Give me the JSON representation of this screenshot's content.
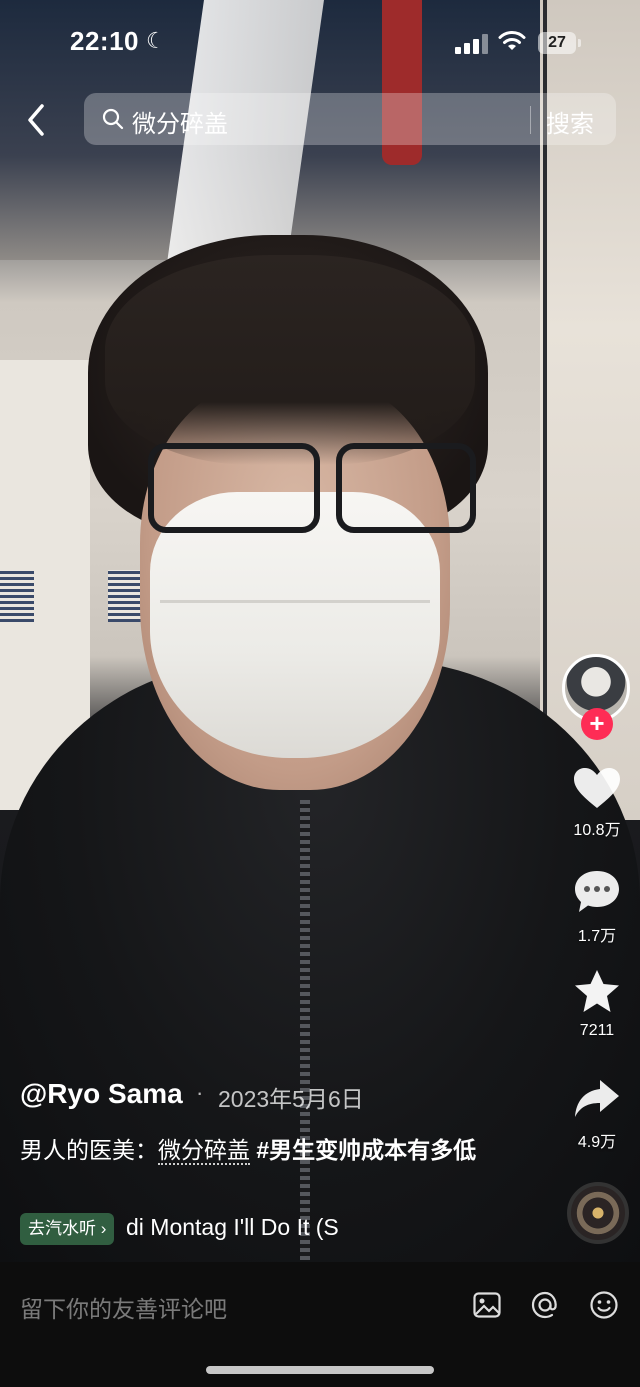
{
  "status": {
    "time": "22:10",
    "battery": "27"
  },
  "search": {
    "query": "微分碎盖",
    "button": "搜索"
  },
  "actions": {
    "likes": "10.8万",
    "comments": "1.7万",
    "favorites": "7211",
    "shares": "4.9万"
  },
  "post": {
    "author": "@Ryo Sama",
    "separator": "·",
    "date": "2023年5月6日",
    "desc_prefix": "男人的医美：",
    "desc_keyword": "微分碎盖",
    "desc_tag": " #男生变帅成本有多低",
    "music_chip": "去汽水听",
    "music_text": "di Montag   I'll Do It (S"
  },
  "comment": {
    "placeholder": "留下你的友善评论吧"
  },
  "icons": [
    "back-icon",
    "search-icon",
    "heart-icon",
    "comment-icon",
    "star-icon",
    "share-icon",
    "image-icon",
    "at-icon",
    "emoji-icon"
  ],
  "colors": {
    "follow": "#fe2c55",
    "comment_bar": "#0d0d0d",
    "music_chip": "#3c7850"
  }
}
